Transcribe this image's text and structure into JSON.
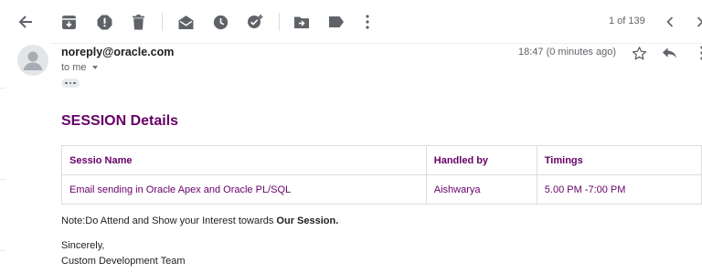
{
  "toolbar": {
    "pager": "1 of 139",
    "icons": [
      "back-arrow-icon",
      "archive-icon",
      "report-spam-icon",
      "delete-icon",
      "mark-unread-icon",
      "snooze-icon",
      "add-task-icon",
      "move-to-icon",
      "labels-icon",
      "more-vert-icon",
      "prev-chevron-icon",
      "next-chevron-icon"
    ]
  },
  "message": {
    "sender": "noreply@oracle.com",
    "recipient": "to me",
    "timestamp": "18:47 (0 minutes ago)",
    "header_icons": [
      "star-icon",
      "reply-icon",
      "more-vert-icon"
    ]
  },
  "body": {
    "title": "SESSION Details",
    "table": {
      "headers": [
        "Sessio Name",
        "Handled by",
        "Timings"
      ],
      "rows": [
        [
          "Email sending in Oracle Apex and Oracle PL/SQL",
          "Aishwarya",
          "5.00 PM -7:00 PM"
        ]
      ]
    },
    "note_prefix": "Note:Do Attend and Show your Interest towards ",
    "note_bold": "Our Session.",
    "closing": "Sincerely,",
    "signature": "Custom Development Team"
  },
  "colors": {
    "accent": "#660066",
    "icon": "#5f6368",
    "text": "#202124"
  }
}
